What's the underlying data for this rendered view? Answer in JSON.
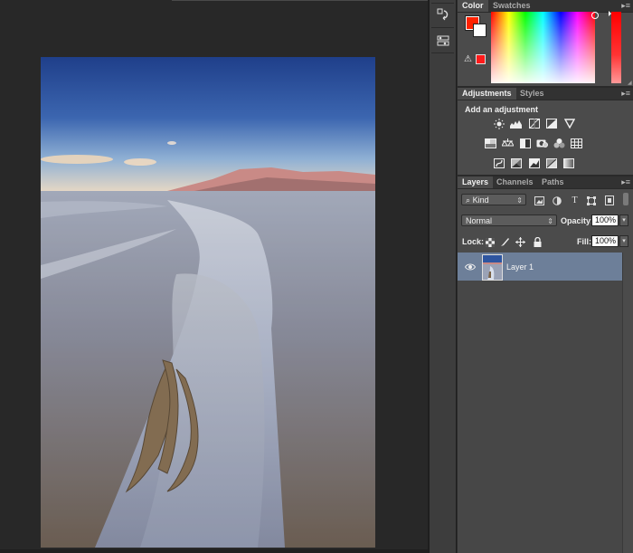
{
  "color_panel": {
    "tabs": [
      {
        "label": "Color",
        "active": true
      },
      {
        "label": "Swatches",
        "active": false
      }
    ],
    "foreground_color": "#ff2200",
    "background_color": "#ffffff",
    "warning_icon": "gamut-warning-icon"
  },
  "adjustments_panel": {
    "tabs": [
      {
        "label": "Adjustments",
        "active": true
      },
      {
        "label": "Styles",
        "active": false
      }
    ],
    "title": "Add an adjustment",
    "rows": [
      [
        "brightness-contrast-icon",
        "levels-icon",
        "curves-icon",
        "exposure-icon",
        "vibrance-icon"
      ],
      [
        "hue-saturation-icon",
        "color-balance-icon",
        "black-white-icon",
        "photo-filter-icon",
        "channel-mixer-icon",
        "color-lookup-icon"
      ],
      [
        "invert-icon",
        "posterize-icon",
        "threshold-icon",
        "selective-color-icon",
        "gradient-map-icon"
      ]
    ]
  },
  "layers_panel": {
    "tabs": [
      {
        "label": "Layers",
        "active": true
      },
      {
        "label": "Channels",
        "active": false
      },
      {
        "label": "Paths",
        "active": false
      }
    ],
    "filter_kind": "Kind",
    "blend_mode": "Normal",
    "opacity_label": "Opacity:",
    "opacity_value": "100%",
    "lock_label": "Lock:",
    "fill_label": "Fill:",
    "fill_value": "100%",
    "layers": [
      {
        "name": "Layer 1",
        "visible": true,
        "selected": true
      }
    ]
  },
  "toolstrip": {
    "buttons": [
      "history-icon",
      "properties-icon"
    ]
  },
  "accent_colors": {
    "selection": "#6d7f99",
    "panel_bg": "#4b4b4b",
    "canvas_bg": "#282828"
  }
}
